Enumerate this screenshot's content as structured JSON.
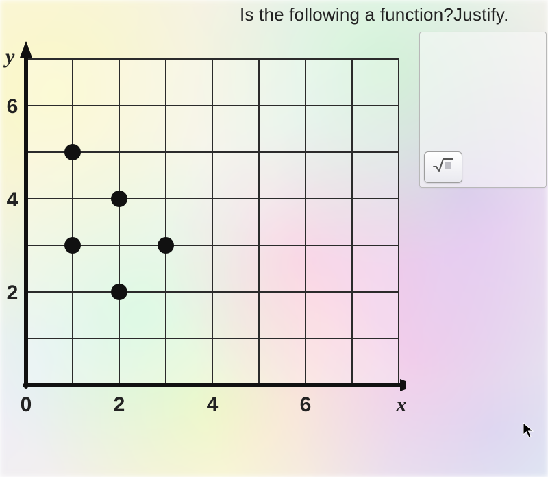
{
  "question": "Is the following a function?Justify.",
  "answer_panel": {
    "placeholder": "",
    "tool_button_name": "square-root-icon"
  },
  "chart_data": {
    "type": "scatter",
    "title": "",
    "xlabel": "x",
    "ylabel": "y",
    "xlim": [
      0,
      8
    ],
    "ylim": [
      0,
      7
    ],
    "x_ticks": [
      0,
      2,
      4,
      6
    ],
    "y_ticks": [
      0,
      2,
      4,
      6
    ],
    "grid": true,
    "points": [
      {
        "x": 1,
        "y": 5
      },
      {
        "x": 1,
        "y": 3
      },
      {
        "x": 2,
        "y": 4
      },
      {
        "x": 2,
        "y": 2
      },
      {
        "x": 3,
        "y": 3
      }
    ]
  }
}
